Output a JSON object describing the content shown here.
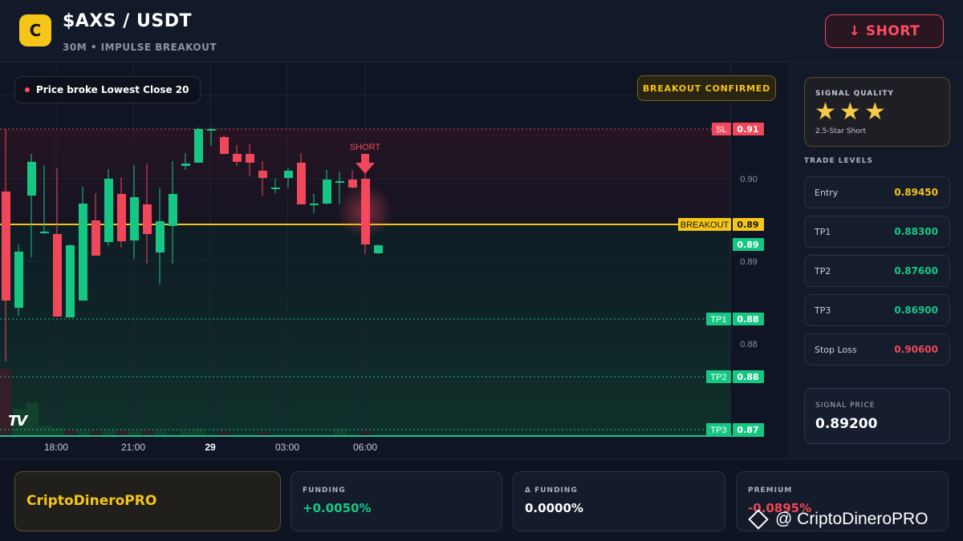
{
  "header": {
    "logo_letter": "C",
    "title": "$AXS / USDT",
    "subtitle": "30M • IMPULSE BREAKOUT",
    "action_label": "↓ SHORT"
  },
  "chart": {
    "signal_pill": "Price broke Lowest Close 20",
    "confirmed_badge": "BREAKOUT CONFIRMED",
    "short_marker": "SHORT",
    "tv_logo": "TV",
    "x_ticks": [
      "18:00",
      "21:00",
      "29",
      "03:00",
      "06:00"
    ],
    "y_ticks": [
      "0.91",
      "0.90",
      "0.89",
      "0.88"
    ],
    "line_labels": [
      {
        "tag": "SL",
        "value": "0.91",
        "color": "#f0475a"
      },
      {
        "tag": "BREAKOUT",
        "value": "0.89",
        "color": "#f5c518"
      },
      {
        "tag": "",
        "value": "0.89",
        "color": "#16c784"
      },
      {
        "tag": "TP1",
        "value": "0.88",
        "color": "#16c784"
      },
      {
        "tag": "TP2",
        "value": "0.88",
        "color": "#16c784"
      },
      {
        "tag": "TP3",
        "value": "0.87",
        "color": "#16c784"
      }
    ],
    "colors": {
      "up": "#16c784",
      "down": "#f0475a",
      "breakout": "#f5c518"
    }
  },
  "side": {
    "quality_caption": "SIGNAL QUALITY",
    "stars": 3,
    "quality_note": "2.5-Star Short",
    "levels_caption": "TRADE LEVELS",
    "levels": [
      {
        "label": "Entry",
        "value": "0.89450",
        "color": "#f5c518"
      },
      {
        "label": "TP1",
        "value": "0.88300",
        "color": "#16c784"
      },
      {
        "label": "TP2",
        "value": "0.87600",
        "color": "#16c784"
      },
      {
        "label": "TP3",
        "value": "0.86900",
        "color": "#16c784"
      },
      {
        "label": "Stop Loss",
        "value": "0.90600",
        "color": "#f0475a"
      }
    ],
    "signal_caption": "SIGNAL PRICE",
    "signal_price": "0.89200"
  },
  "footer": {
    "brand": "CriptoDineroPRO",
    "funding_caption": "FUNDING",
    "funding_value": "+0.0050%",
    "dfunding_caption": "Δ FUNDING",
    "dfunding_value": "0.0000%",
    "premium_caption": "PREMIUM",
    "premium_value": "-0.0895%",
    "watermark": "@ CriptoDineroPRO"
  }
}
